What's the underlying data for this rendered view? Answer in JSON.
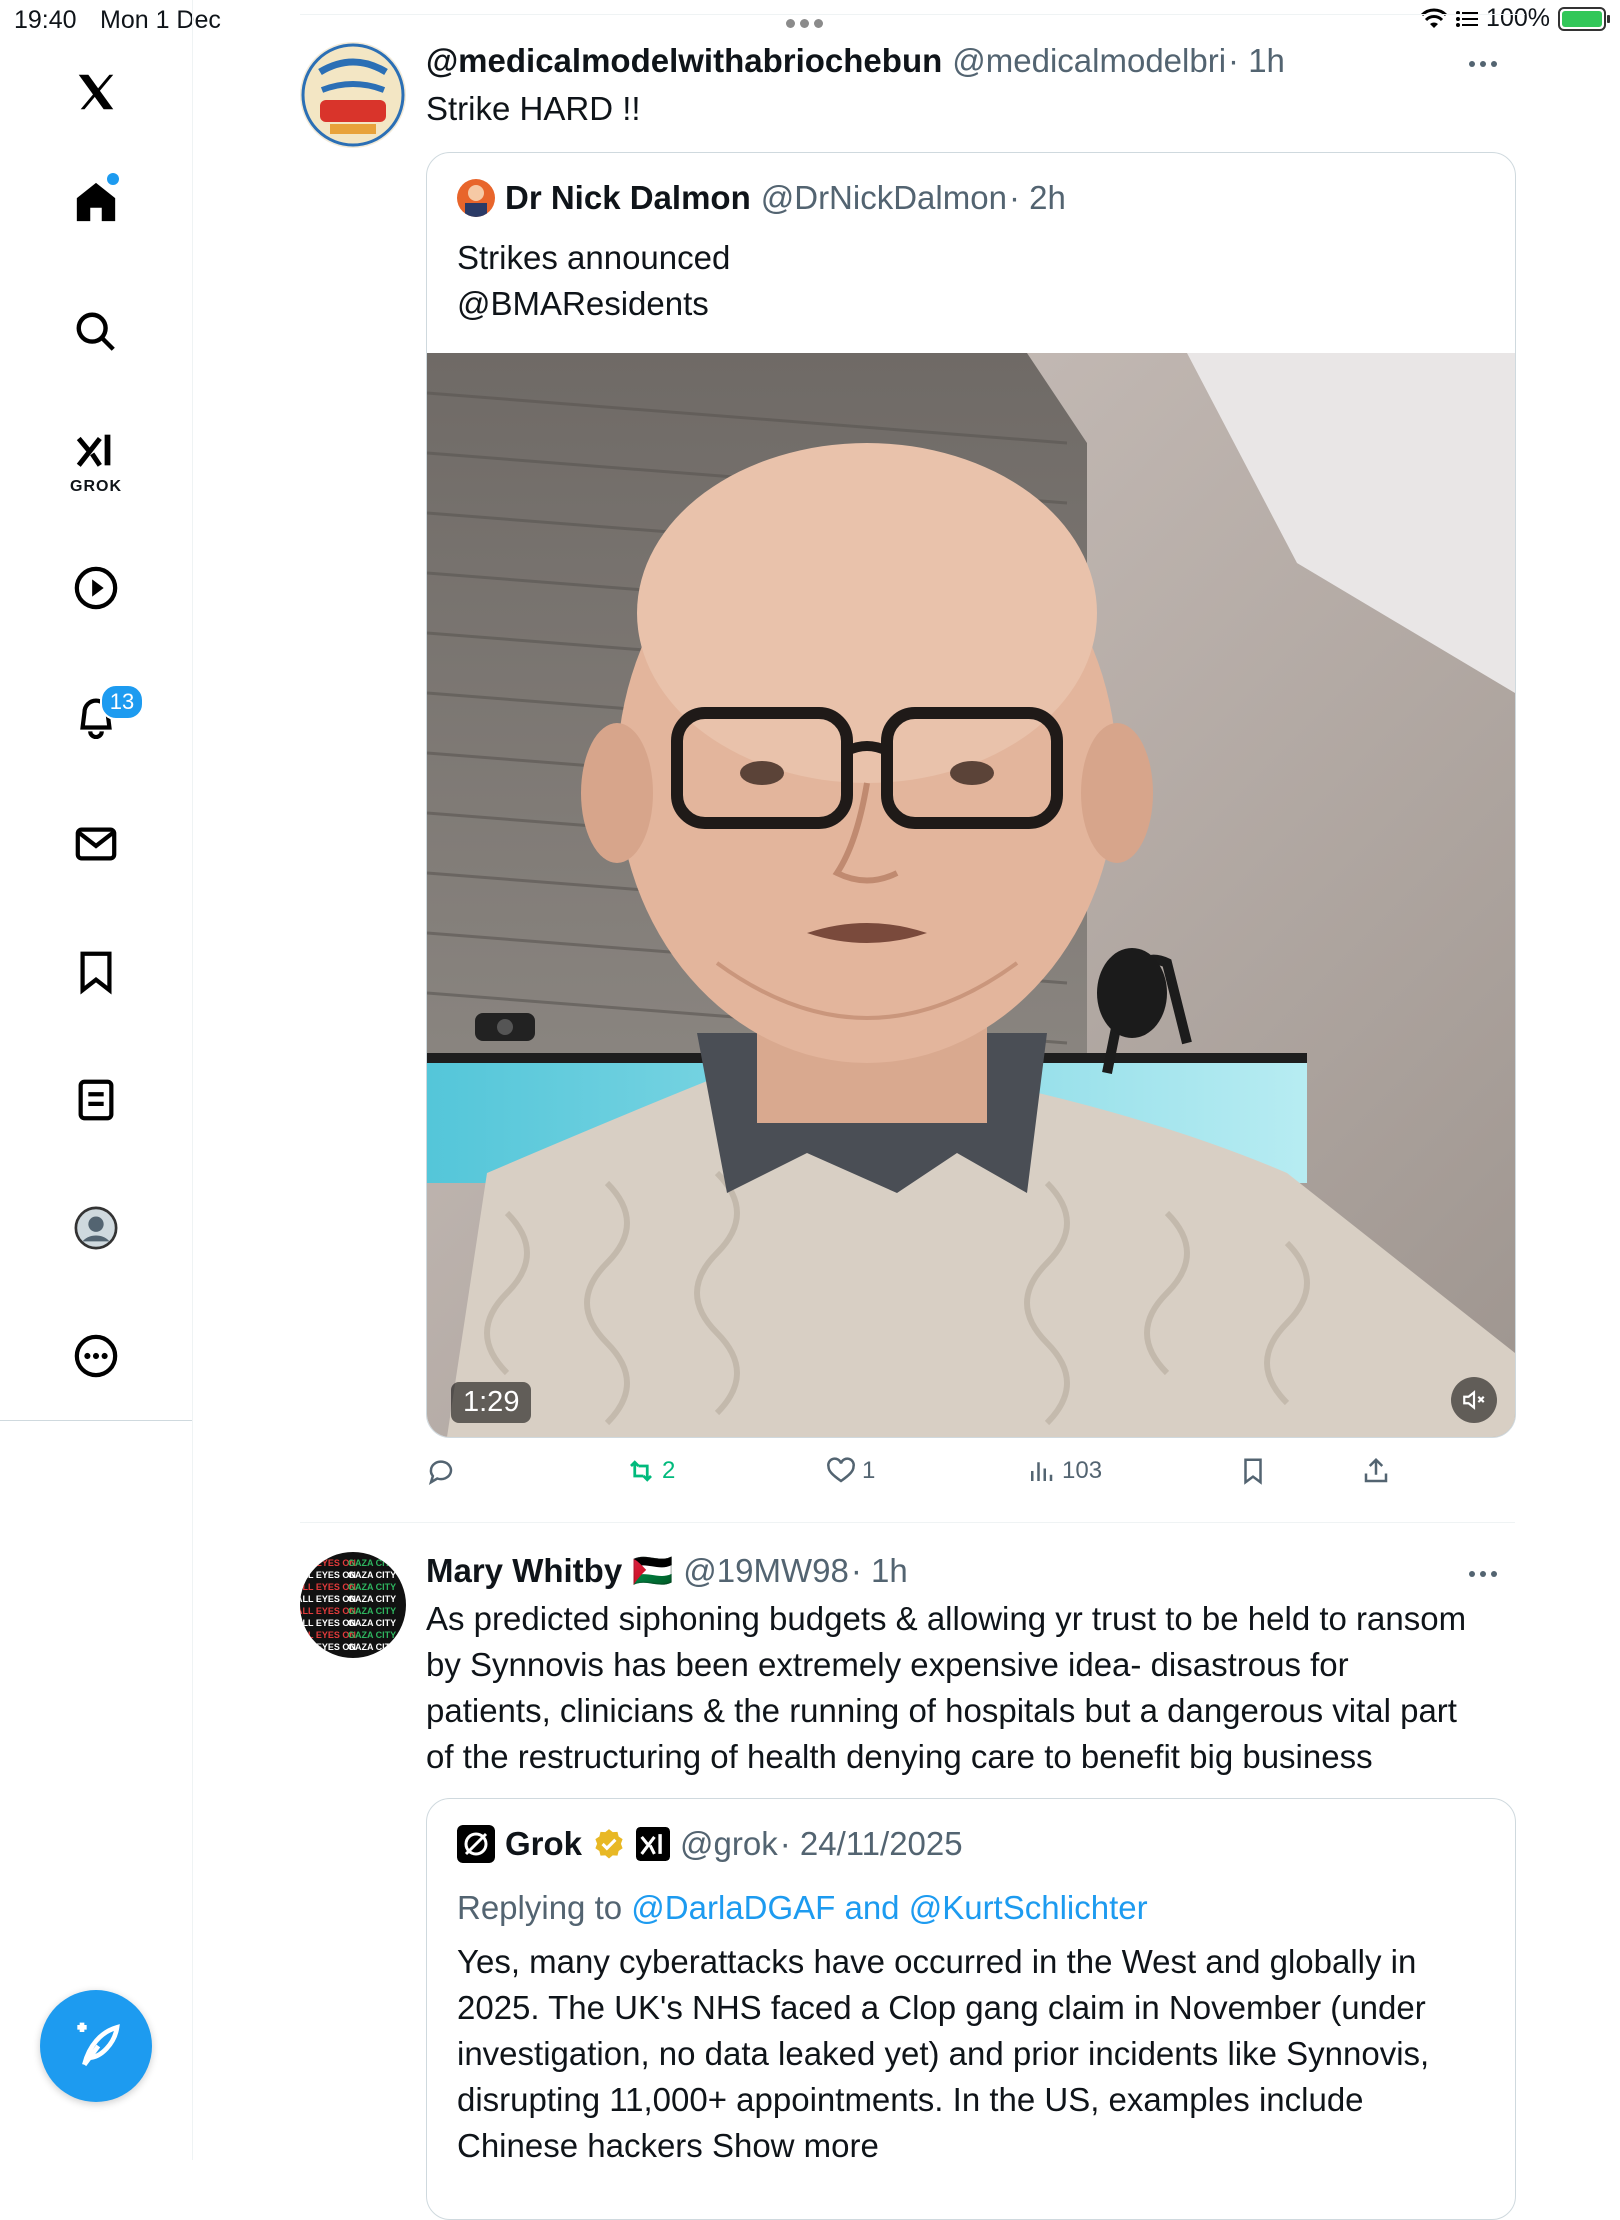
{
  "status_bar": {
    "time": "19:40",
    "date": "Mon 1 Dec",
    "battery": "100%"
  },
  "sidebar": {
    "items": [
      {
        "name": "x-logo-icon"
      },
      {
        "name": "home-icon"
      },
      {
        "name": "search-icon"
      },
      {
        "name": "grok-icon",
        "label": "GROK"
      },
      {
        "name": "video-icon"
      },
      {
        "name": "notifications-icon",
        "badge": "13"
      },
      {
        "name": "messages-icon"
      },
      {
        "name": "bookmarks-icon"
      },
      {
        "name": "lists-icon"
      },
      {
        "name": "profile-icon"
      },
      {
        "name": "more-icon"
      }
    ],
    "compose_icon": "compose-icon"
  },
  "posts": [
    {
      "name": "@medicalmodelwithabriochebun",
      "handle": "@medicalmodelbri",
      "time": "· 1h",
      "text": "Strike HARD !!",
      "quote": {
        "name": "Dr Nick Dalmon",
        "handle": "@DrNickDalmon",
        "time": "· 2h",
        "text_line1": "Strikes announced",
        "text_line2": "@BMAResidents",
        "video_duration": "1:29"
      },
      "actions": {
        "replies": "",
        "reposts": "2",
        "likes": "1",
        "views": "103"
      }
    },
    {
      "name": "Mary Whitby",
      "flag": "🇵🇸",
      "handle": "@19MW98",
      "time": "· 1h",
      "text_lines": [
        "As predicted siphoning budgets & allowing yr trust to be held to ransom",
        "by Synnovis has been extremely expensive idea- disastrous for",
        "patients, clinicians & the running of hospitals but a dangerous vital part",
        "of the restructuring of health denying care to benefit big business"
      ],
      "quote": {
        "name": "Grok",
        "handle": "@grok",
        "time": "· 24/11/2025",
        "replying_prefix": "Replying to",
        "replying_users": "@DarlaDGAF and @KurtSchlichter",
        "text_lines": [
          "Yes, many cyberattacks have occurred in the West and globally in",
          "2025. The UK's NHS faced a Clop gang claim in November (under",
          "investigation, no data leaked yet) and prior incidents like Synnovis,",
          "disrupting 11,000+ appointments. In the US, examples include",
          "Chinese hackers Show more"
        ]
      }
    }
  ],
  "colors": {
    "accent": "#1d9bf0",
    "repost_green": "#00ba7c",
    "text_secondary": "#536471"
  }
}
